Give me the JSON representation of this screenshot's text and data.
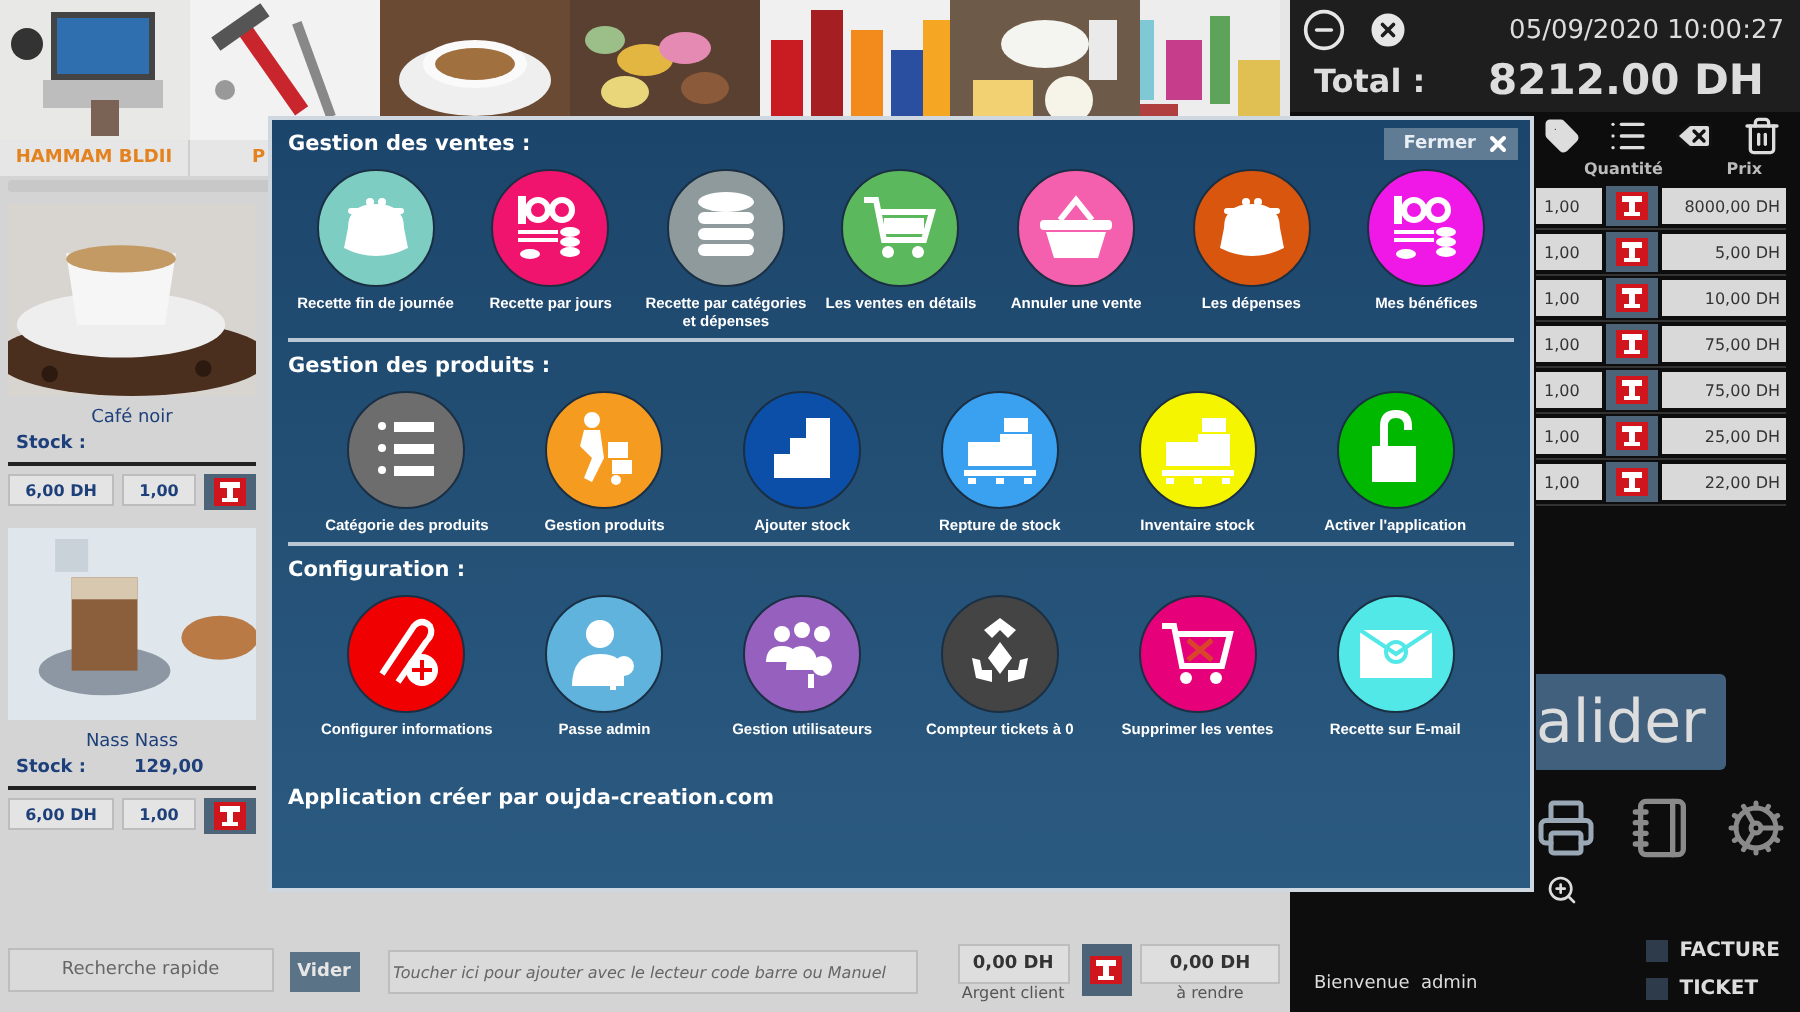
{
  "categories": [
    {
      "kind": "picture",
      "label": "HAMMAM BLDII"
    },
    {
      "kind": "picture",
      "label": "P"
    },
    {
      "kind": "picture"
    },
    {
      "kind": "picture"
    },
    {
      "kind": "picture"
    },
    {
      "kind": "picture"
    },
    {
      "kind": "picture"
    }
  ],
  "products": [
    {
      "name": "Café noir",
      "stock_label": "Stock :",
      "price": "6,00 DH",
      "qty": "1,00"
    },
    {
      "name": "Nass Nass",
      "stock_label": "Stock :",
      "stock": "129,00",
      "price": "6,00 DH",
      "qty": "1,00"
    }
  ],
  "bottom_bar": {
    "search": {
      "placeholder": "Recherche rapide"
    },
    "clear_button": "Vider",
    "barcode": {
      "placeholder": "Toucher ici pour ajouter avec le lecteur code barre ou Manuel"
    },
    "client_amount": "0,00 DH",
    "client_label": "Argent client",
    "change_amount": "0,00 DH",
    "change_label": "à rendre"
  },
  "register": {
    "datetime": "05/09/2020 10:00:27",
    "total_label": "Total :",
    "total_value": "8212.00 DH",
    "columns": [
      "Quantité",
      "Prix"
    ],
    "lines": [
      {
        "qty": "1,00",
        "price": "8000,00 DH"
      },
      {
        "qty": "1,00",
        "price": "5,00 DH"
      },
      {
        "qty": "1,00",
        "price": "10,00 DH"
      },
      {
        "qty": "1,00",
        "price": "75,00 DH"
      },
      {
        "qty": "1,00",
        "price": "75,00 DH"
      },
      {
        "qty": "1,00",
        "price": "25,00 DH"
      },
      {
        "qty": "1,00",
        "price": "22,00 DH"
      }
    ],
    "validate_button": "alider",
    "options": [
      {
        "label": "FACTURE",
        "checked": false
      },
      {
        "label": "TICKET",
        "checked": false
      }
    ],
    "welcome": "Bienvenue  admin"
  },
  "modal": {
    "close_button": "Fermer",
    "sections": [
      {
        "title": "Gestion des ventes :",
        "items": [
          {
            "label": "Recette fin de journée",
            "kind": "purse",
            "color": "#7dcdc3"
          },
          {
            "label": "Recette par jours",
            "kind": "money",
            "color": "#f0146e"
          },
          {
            "label": "Recette par catégories\net dépenses",
            "kind": "database",
            "color": "#8e9a9b"
          },
          {
            "label": "Les ventes en détails",
            "kind": "cart",
            "color": "#5cb85c"
          },
          {
            "label": "Annuler une vente",
            "kind": "basket",
            "color": "#f45fae"
          },
          {
            "label": "Les dépenses",
            "kind": "purse",
            "color": "#d9560f"
          },
          {
            "label": "Mes bénéfices",
            "kind": "money",
            "color": "#f018e6"
          }
        ]
      },
      {
        "title": "Gestion des produits :",
        "items": [
          {
            "label": "Catégorie des produits",
            "kind": "checklist",
            "color": "#6d6d6d"
          },
          {
            "label": "Gestion produits",
            "kind": "mover",
            "color": "#f59b1f"
          },
          {
            "label": "Ajouter stock",
            "kind": "boxes",
            "color": "#0b4fa8"
          },
          {
            "label": "Repture de stock",
            "kind": "pallet",
            "color": "#3aa0f0"
          },
          {
            "label": "Inventaire stock",
            "kind": "pallet",
            "color": "#f5f500"
          },
          {
            "label": "Activer l'application",
            "kind": "lock",
            "color": "#00b800"
          }
        ]
      },
      {
        "title": "Configuration :",
        "items": [
          {
            "label": "Configurer informations",
            "kind": "clip",
            "color": "#f00000"
          },
          {
            "label": "Passe admin",
            "kind": "userkey",
            "color": "#5fb3dd"
          },
          {
            "label": "Gestion utilisateurs",
            "kind": "userskey",
            "color": "#9660bf"
          },
          {
            "label": "Compteur tickets à 0",
            "kind": "recycle",
            "color": "#444444"
          },
          {
            "label": "Supprimer les ventes",
            "kind": "cartx",
            "color": "#e6007a"
          },
          {
            "label": "Recette sur E-mail",
            "kind": "mail",
            "color": "#52e8e8"
          }
        ]
      }
    ],
    "footer": "Application créer par oujda-creation.com"
  }
}
